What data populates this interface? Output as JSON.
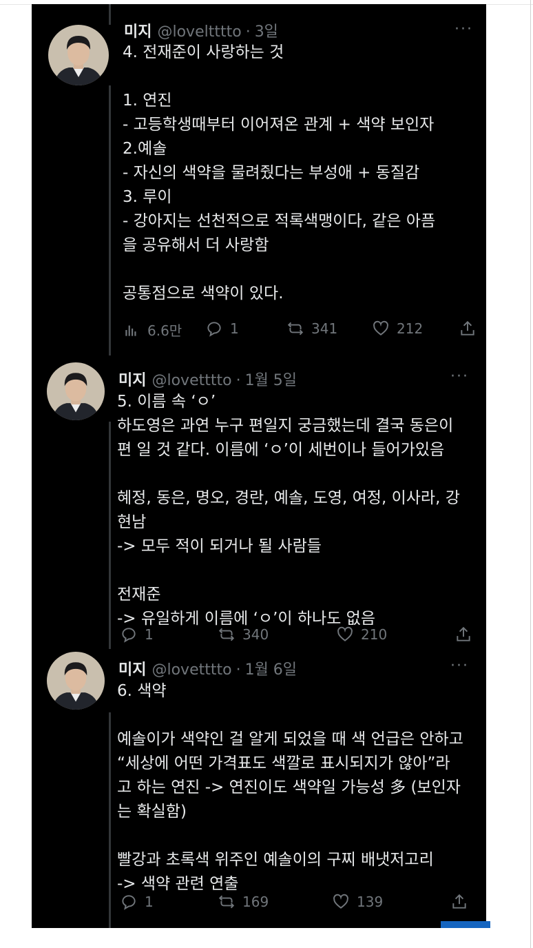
{
  "tweets": [
    {
      "name": "미지",
      "handle": "@loveltttto",
      "time": "3일",
      "text": "4. 전재준이 사랑하는 것\n\n1. 연진\n- 고등학생때부터 이어져온 관계 + 색약 보인자\n2.예솔\n- 자신의 색약을 물려줬다는 부성애 + 동질감\n3. 루이\n- 강아지는 선천적으로 적록색맹이다, 같은 아픔\n을 공유해서 더 사랑함\n\n공통점으로 색약이 있다.",
      "views": "6.6만",
      "replies": "1",
      "retweets": "341",
      "likes": "212"
    },
    {
      "name": "미지",
      "handle": "@lovetttto",
      "time": "1월 5일",
      "text": "5. 이름 속 ‘ㅇ’\n하도영은 과연 누구 편일지 궁금했는데 결국 동은이\n편 일 것 같다. 이름에 ‘ㅇ’이 세번이나 들어가있음\n\n혜정, 동은, 명오, 경란, 예솔, 도영, 여정, 이사라, 강\n현남\n-> 모두 적이 되거나 될 사람들\n\n전재준\n-> 유일하게 이름에 ‘ㅇ’이 하나도 없음",
      "replies": "1",
      "retweets": "340",
      "likes": "210"
    },
    {
      "name": "미지",
      "handle": "@lovetttto",
      "time": "1월 6일",
      "text": "6. 색약\n\n예솔이가 색약인 걸 알게 되었을 때 색 언급은 안하고\n“세상에 어떤 가격표도 색깔로 표시되지가 않아”라\n고 하는 연진 -> 연진이도 색약일 가능성 多 (보인자\n는 확실함)\n\n빨강과 초록색 위주인 예솔이의 구찌 배냇저고리\n-> 색약 관련 연출",
      "replies": "1",
      "retweets": "169",
      "likes": "139"
    }
  ],
  "more_label": "···"
}
